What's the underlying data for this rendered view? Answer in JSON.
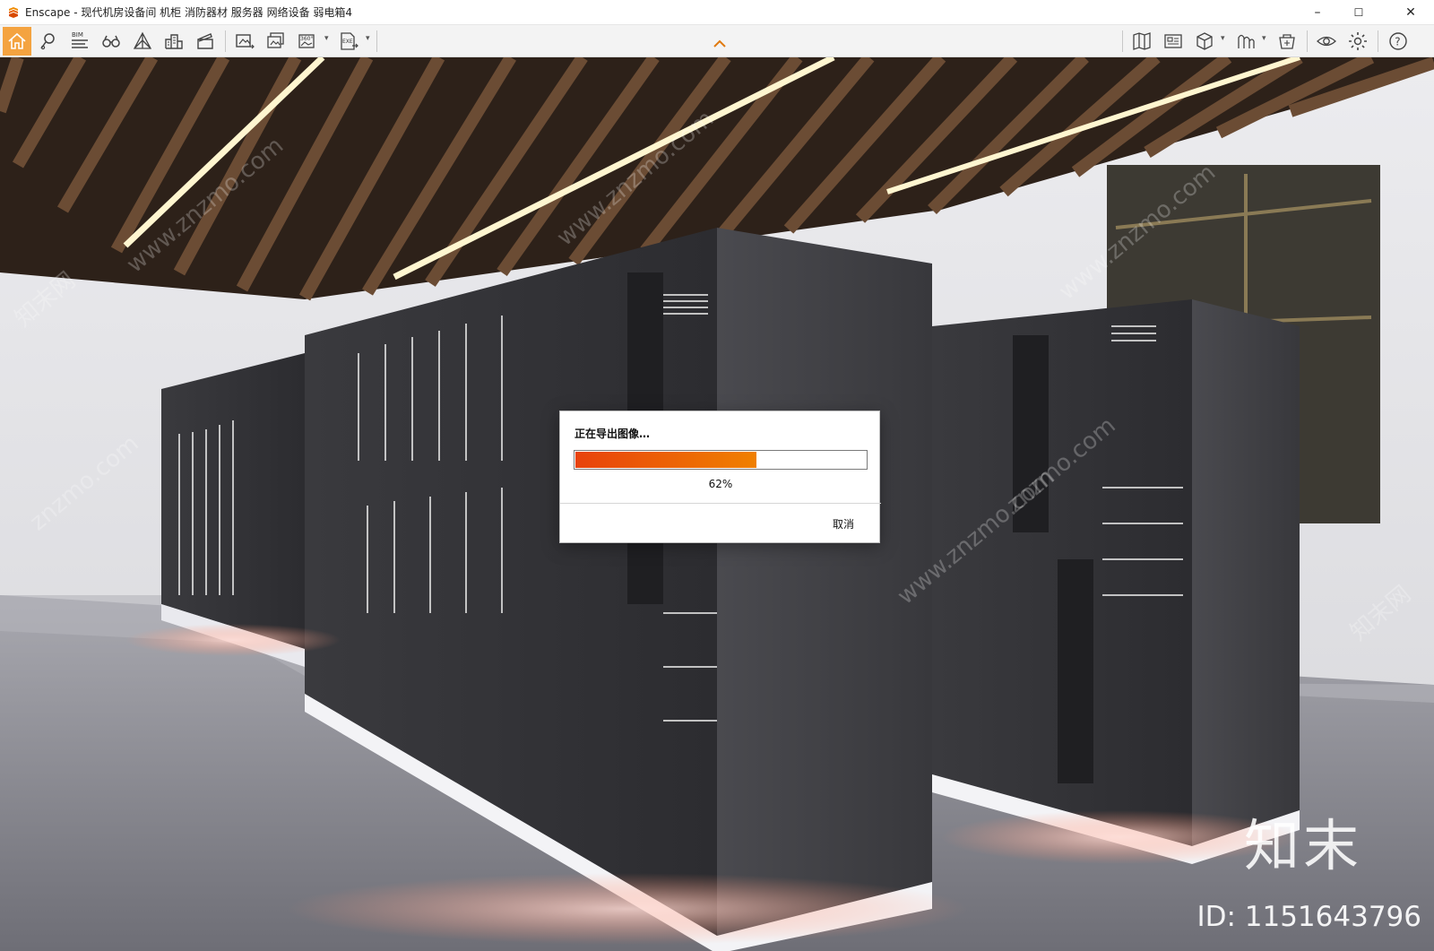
{
  "window": {
    "title": "Enscape - 现代机房设备间 机柜 消防器材 服务器 网络设备 弱电箱4",
    "controls": {
      "minimize": "–",
      "maximize": "☐",
      "close": "✕"
    }
  },
  "toolbar": {
    "bim_label": "BIM",
    "pano_label": "360°",
    "exe_label": "EXE",
    "accent_color": "#f4a340"
  },
  "dialog": {
    "title": "正在导出图像…",
    "progress_percent": 62,
    "progress_text": "62%",
    "cancel_label": "取消",
    "fill_colors": [
      "#e8420c",
      "#f08000"
    ]
  },
  "watermark": {
    "logo_text": "知末",
    "id_text": "ID: 1151643796",
    "diagonal": [
      "www.znzmo.com",
      "znzmo.com",
      "知末网"
    ]
  },
  "icons": [
    "home-icon",
    "location-pin-icon",
    "bim-icon",
    "binoculars-icon",
    "perspective-icon",
    "buildings-icon",
    "clapperboard-icon",
    "screenshot-icon",
    "batch-render-icon",
    "panorama-icon",
    "exe-export-icon",
    "map-icon",
    "views-icon",
    "cube-icon",
    "asset-library-icon",
    "material-icon",
    "visibility-icon",
    "settings-icon",
    "help-icon"
  ]
}
